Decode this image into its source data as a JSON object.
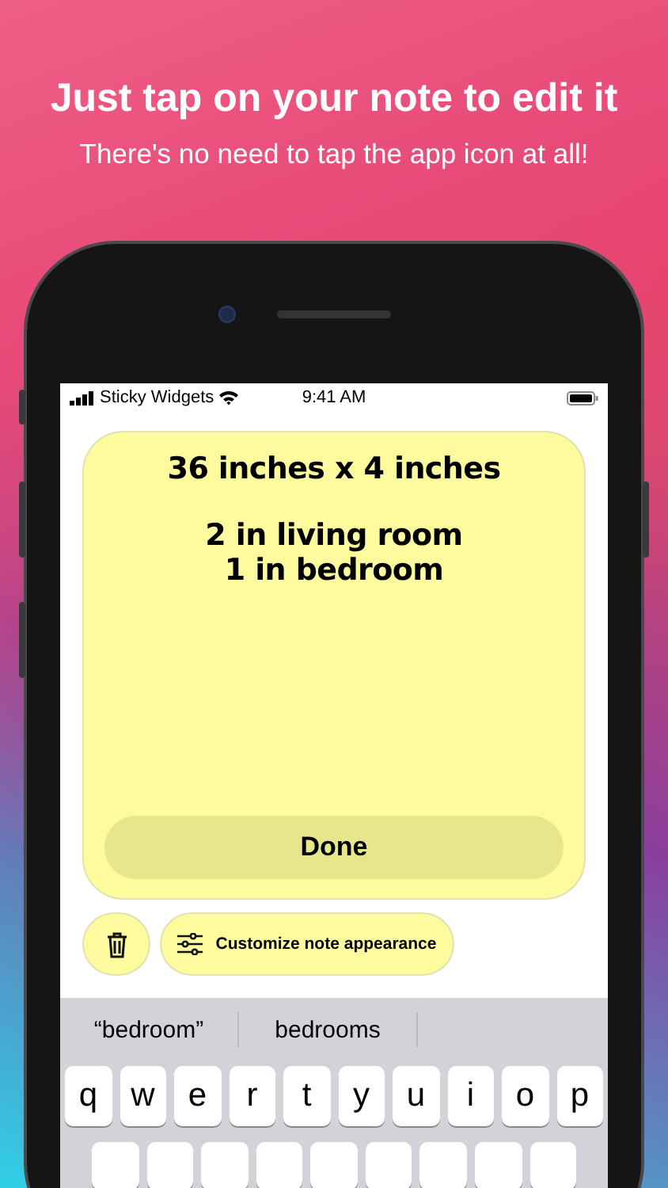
{
  "headline": "Just tap on your note to edit it",
  "subtitle": "There's no need to tap the app icon at all!",
  "status_bar": {
    "carrier": "Sticky Widgets",
    "time": "9:41 AM"
  },
  "note": {
    "paragraphs": [
      [
        "36 inches x 4 inches"
      ],
      [
        "2 in living room",
        "1 in bedroom"
      ]
    ],
    "done_label": "Done"
  },
  "actions": [
    {
      "kind": "delete"
    },
    {
      "kind": "customize",
      "label": "Customize note appearance"
    }
  ],
  "keyboard": {
    "suggestions": [
      "“bedroom”",
      "bedrooms"
    ],
    "keys": [
      "q",
      "w",
      "e",
      "r",
      "t",
      "y",
      "u",
      "i",
      "o",
      "p"
    ]
  }
}
